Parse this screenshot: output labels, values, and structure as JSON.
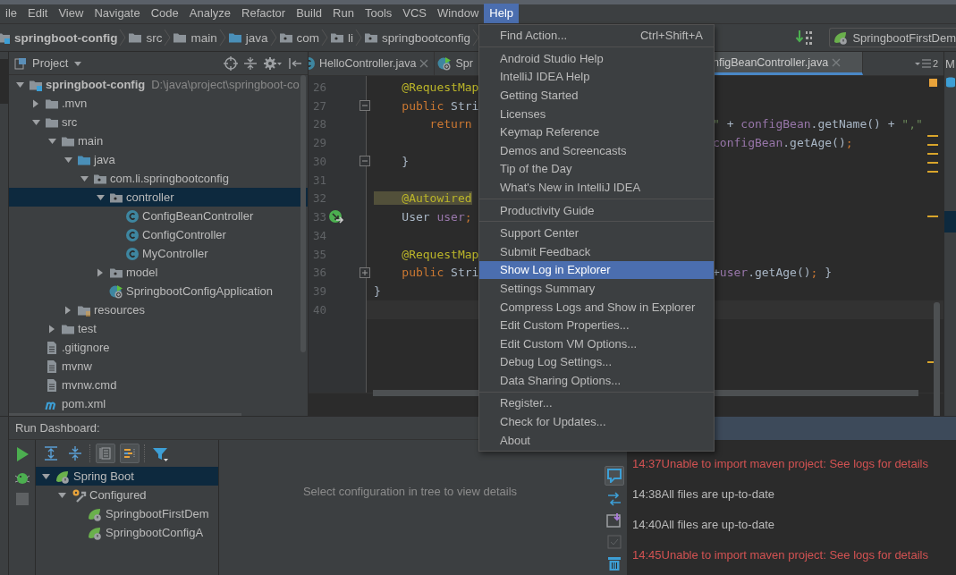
{
  "menubar": [
    {
      "label": "ile",
      "selected": false
    },
    {
      "label": "Edit",
      "selected": false
    },
    {
      "label": "View",
      "selected": false
    },
    {
      "label": "Navigate",
      "selected": false
    },
    {
      "label": "Code",
      "selected": false
    },
    {
      "label": "Analyze",
      "selected": false
    },
    {
      "label": "Refactor",
      "selected": false
    },
    {
      "label": "Build",
      "selected": false
    },
    {
      "label": "Run",
      "selected": false
    },
    {
      "label": "Tools",
      "selected": false
    },
    {
      "label": "VCS",
      "selected": false
    },
    {
      "label": "Window",
      "selected": false
    },
    {
      "label": "Help",
      "selected": true
    }
  ],
  "breadcrumbs": [
    {
      "label": "springboot-config",
      "kind": "module"
    },
    {
      "label": "src",
      "kind": "folder"
    },
    {
      "label": "main",
      "kind": "folder"
    },
    {
      "label": "java",
      "kind": "source"
    },
    {
      "label": "com",
      "kind": "package"
    },
    {
      "label": "li",
      "kind": "package"
    },
    {
      "label": "springbootconfig",
      "kind": "package"
    }
  ],
  "run_config": {
    "label": "SpringbootFirstDem"
  },
  "project_panel": {
    "title": "Project",
    "tree": [
      {
        "label": "springboot-config",
        "note": "D:\\java\\project\\springboot-co",
        "kind": "module",
        "expanded": true,
        "selected": false,
        "children": [
          {
            "label": ".mvn",
            "kind": "folder",
            "expanded": false,
            "selected": false
          },
          {
            "label": "src",
            "kind": "folder",
            "expanded": true,
            "selected": false,
            "children": [
              {
                "label": "main",
                "kind": "folder",
                "expanded": true,
                "selected": false,
                "children": [
                  {
                    "label": "java",
                    "kind": "source",
                    "expanded": true,
                    "selected": false,
                    "children": [
                      {
                        "label": "com.li.springbootconfig",
                        "kind": "package",
                        "expanded": true,
                        "selected": false,
                        "children": [
                          {
                            "label": "controller",
                            "kind": "package",
                            "expanded": true,
                            "selected": true,
                            "children": [
                              {
                                "label": "ConfigBeanController",
                                "kind": "class",
                                "selected": false
                              },
                              {
                                "label": "ConfigController",
                                "kind": "class",
                                "selected": false
                              },
                              {
                                "label": "MyController",
                                "kind": "class",
                                "selected": false
                              }
                            ]
                          },
                          {
                            "label": "model",
                            "kind": "package",
                            "expanded": false,
                            "selected": false
                          },
                          {
                            "label": "SpringbootConfigApplication",
                            "kind": "app",
                            "selected": false
                          }
                        ]
                      }
                    ]
                  },
                  {
                    "label": "resources",
                    "kind": "resources",
                    "expanded": false,
                    "selected": false
                  }
                ]
              },
              {
                "label": "test",
                "kind": "folder",
                "expanded": false,
                "selected": false
              }
            ]
          },
          {
            "label": ".gitignore",
            "kind": "file",
            "selected": false
          },
          {
            "label": "mvnw",
            "kind": "file",
            "selected": false
          },
          {
            "label": "mvnw.cmd",
            "kind": "file",
            "selected": false
          },
          {
            "label": "pom.xml",
            "kind": "maven",
            "selected": false
          }
        ]
      }
    ]
  },
  "editor": {
    "tabs": [
      {
        "label": "HelloController.java",
        "kind": "class",
        "selected": false
      },
      {
        "label": "Spr",
        "kind": "app",
        "selected": false
      },
      {
        "label": "nfigBeanController.java",
        "kind": "none",
        "selected": true
      }
    ],
    "tab_count": "2",
    "lines": [
      {
        "number": "26",
        "code": [
          {
            "text": "    @RequestMap",
            "kind": "annotation"
          }
        ]
      },
      {
        "number": "27",
        "gutter": {
          "kind": "fold-start"
        },
        "code": [
          {
            "text": "    public ",
            "kind": "keyword"
          },
          {
            "text": "Stri"
          }
        ]
      },
      {
        "number": "28",
        "code": [
          {
            "text": "        return",
            "kind": "keyword"
          }
        ],
        "tail": [
          {
            "text": "\"",
            "kind": "string"
          },
          {
            "text": " + "
          },
          {
            "text": "configBean",
            "kind": "field"
          },
          {
            "text": ".getName() + "
          },
          {
            "text": "\",\"",
            "kind": "string"
          }
        ]
      },
      {
        "number": "29",
        "tail": [
          {
            "text": "configBean",
            "kind": "field"
          },
          {
            "text": ".getAge()"
          },
          {
            "text": ";",
            "kind": "keyword"
          }
        ]
      },
      {
        "number": "30",
        "gutter": {
          "kind": "fold-end"
        },
        "code": [
          {
            "text": "    }"
          }
        ]
      },
      {
        "number": "31"
      },
      {
        "number": "32",
        "code": [
          {
            "text": "    @Autowired",
            "kind": "marked"
          }
        ]
      },
      {
        "number": "33",
        "gutter": {
          "kind": "bean"
        },
        "code": [
          {
            "text": "    User "
          },
          {
            "text": "user",
            "kind": "field"
          },
          {
            "text": ";",
            "kind": "keyword"
          }
        ]
      },
      {
        "number": "34"
      },
      {
        "number": "35",
        "code": [
          {
            "text": "    @RequestMap",
            "kind": "annotation"
          }
        ]
      },
      {
        "number": "36",
        "gutter": {
          "kind": "fold-collapsed"
        },
        "code": [
          {
            "text": "    public ",
            "kind": "keyword"
          },
          {
            "text": "Stri"
          }
        ],
        "tail": [
          {
            "text": "+"
          },
          {
            "text": "user",
            "kind": "field"
          },
          {
            "text": ".getAge()"
          },
          {
            "text": ";",
            "kind": "keyword"
          },
          {
            "text": " }"
          }
        ]
      },
      {
        "number": "39",
        "code": [
          {
            "text": "}"
          }
        ]
      },
      {
        "number": "40",
        "current": true
      }
    ]
  },
  "right_panel": {
    "label": "M"
  },
  "help_menu": [
    {
      "label": "Find Action...",
      "shortcut": "Ctrl+Shift+A",
      "selected": false
    },
    {
      "kind": "separator"
    },
    {
      "label": "Android Studio Help",
      "selected": false
    },
    {
      "label": "IntelliJ IDEA Help",
      "selected": false
    },
    {
      "label": "Getting Started",
      "selected": false
    },
    {
      "label": "Licenses",
      "selected": false
    },
    {
      "label": "Keymap Reference",
      "selected": false
    },
    {
      "label": "Demos and Screencasts",
      "selected": false
    },
    {
      "label": "Tip of the Day",
      "selected": false
    },
    {
      "label": "What's New in IntelliJ IDEA",
      "selected": false
    },
    {
      "kind": "separator"
    },
    {
      "label": "Productivity Guide",
      "selected": false
    },
    {
      "kind": "separator"
    },
    {
      "label": "Support Center",
      "selected": false
    },
    {
      "label": "Submit Feedback",
      "selected": false
    },
    {
      "label": "Show Log in Explorer",
      "selected": true
    },
    {
      "label": "Settings Summary",
      "selected": false
    },
    {
      "label": "Compress Logs and Show in Explorer",
      "selected": false
    },
    {
      "label": "Edit Custom Properties...",
      "selected": false
    },
    {
      "label": "Edit Custom VM Options...",
      "selected": false
    },
    {
      "label": "Debug Log Settings...",
      "selected": false
    },
    {
      "label": "Data Sharing Options...",
      "selected": false
    },
    {
      "kind": "separator"
    },
    {
      "label": "Register...",
      "selected": false
    },
    {
      "label": "Check for Updates...",
      "selected": false
    },
    {
      "label": "About",
      "selected": false
    }
  ],
  "run_dashboard": {
    "title": "Run Dashboard:",
    "toolbar": [
      {
        "kind": "expand-all",
        "pressed": false
      },
      {
        "kind": "collapse-all",
        "pressed": false
      },
      {
        "kind": "group-config",
        "pressed": true
      },
      {
        "kind": "group-type",
        "pressed": true
      },
      {
        "kind": "filter",
        "pressed": false
      }
    ],
    "tree": [
      {
        "label": "Spring Boot",
        "kind": "spring",
        "expanded": true,
        "selected": true,
        "children": [
          {
            "label": "Configured",
            "kind": "group",
            "expanded": true,
            "selected": false,
            "children": [
              {
                "label": "SpringbootFirstDem",
                "kind": "spring",
                "selected": false
              },
              {
                "label": "SpringbootConfigA",
                "kind": "spring",
                "selected": false
              }
            ]
          }
        ]
      }
    ],
    "details_hint": "Select configuration in tree to view details"
  },
  "event_log": {
    "entries": [
      {
        "text": "14:37Unable to import maven project: See logs for details",
        "error": true
      },
      {
        "text": "14:38All files are up-to-date",
        "error": false
      },
      {
        "text": "14:40All files are up-to-date",
        "error": false
      },
      {
        "text": "14:45Unable to import maven project: See logs for details",
        "error": true
      }
    ]
  }
}
